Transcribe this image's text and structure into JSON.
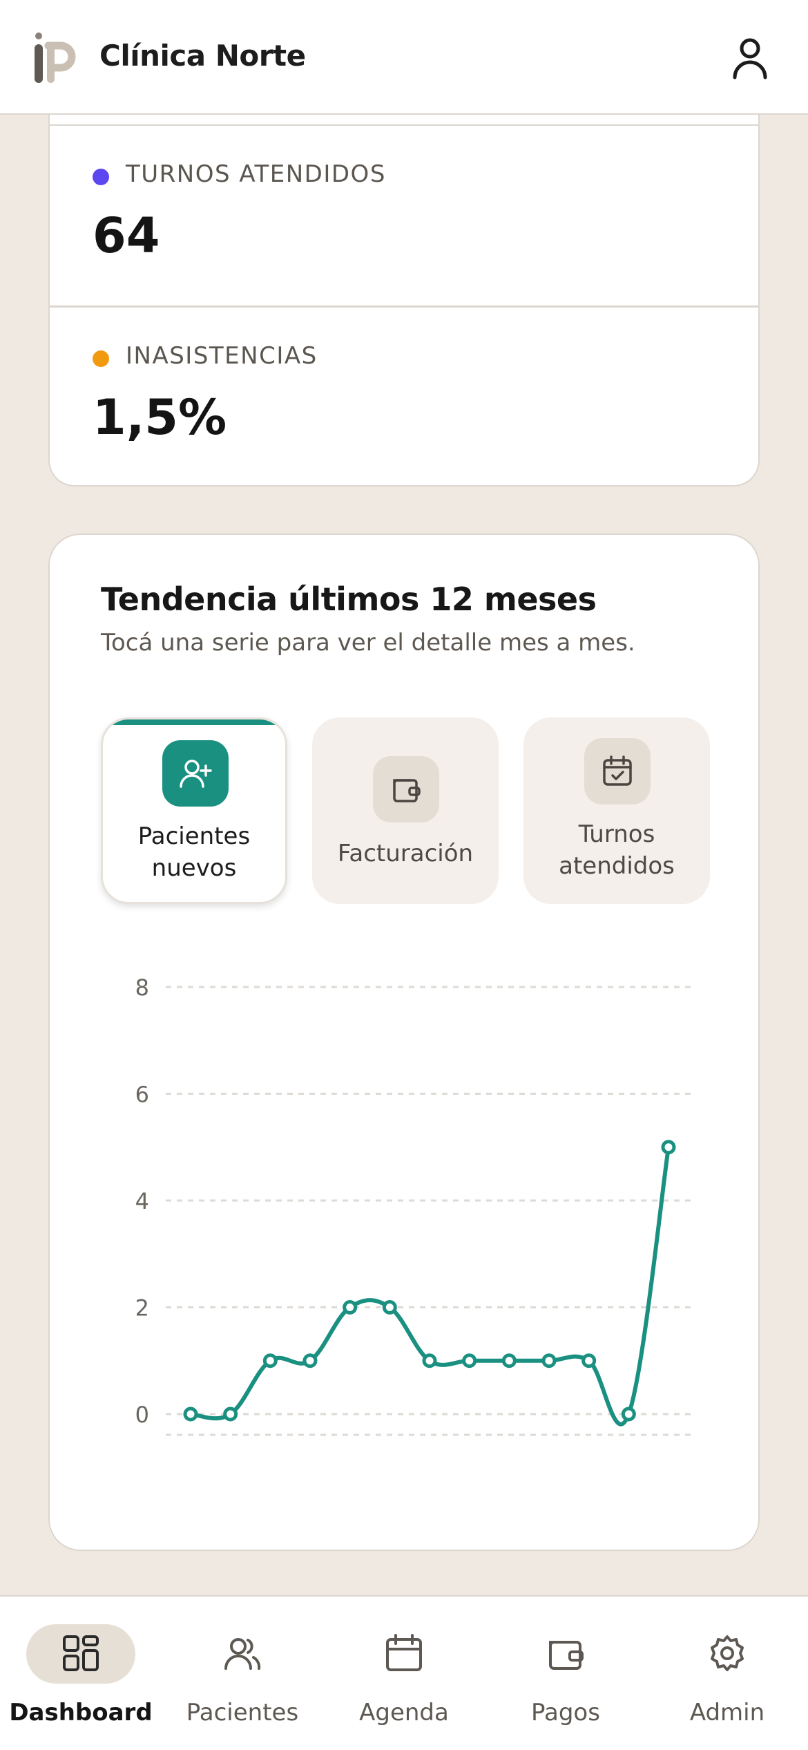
{
  "header": {
    "title": "Clínica Norte"
  },
  "stats": [
    {
      "label": "TURNOS ATENDIDOS",
      "value": "64",
      "color": "#5b46f0"
    },
    {
      "label": "INASISTENCIAS",
      "value": "1,5%",
      "color": "#f29a0f"
    }
  ],
  "trend": {
    "title": "Tendencia últimos 12 meses",
    "subtitle": "Tocá una serie para ver el detalle mes a mes.",
    "tabs": [
      {
        "label_line1": "Pacientes",
        "label_line2": "nuevos",
        "icon": "user-plus-icon",
        "active": true
      },
      {
        "label_line1": "Facturación",
        "label_line2": "",
        "icon": "wallet-icon",
        "active": false
      },
      {
        "label_line1": "Turnos",
        "label_line2": "atendidos",
        "icon": "calendar-check-icon",
        "active": false
      }
    ]
  },
  "chart_data": {
    "type": "line",
    "x": [
      1,
      2,
      3,
      4,
      5,
      6,
      7,
      8,
      9,
      10,
      11,
      12,
      13
    ],
    "series": [
      {
        "values": [
          0,
          0,
          1,
          1,
          2,
          2,
          1,
          1,
          1,
          1,
          1,
          0,
          5
        ],
        "color": "#1a9080"
      }
    ],
    "yticks": [
      "0",
      "2",
      "4",
      "6",
      "8"
    ],
    "ylim": [
      0,
      8
    ],
    "grid": true,
    "title": "",
    "xlabel": "",
    "ylabel": ""
  },
  "nav": [
    {
      "label": "Dashboard",
      "icon": "dashboard-icon",
      "active": true
    },
    {
      "label": "Pacientes",
      "icon": "users-icon",
      "active": false
    },
    {
      "label": "Agenda",
      "icon": "calendar-icon",
      "active": false
    },
    {
      "label": "Pagos",
      "icon": "wallet-icon",
      "active": false
    },
    {
      "label": "Admin",
      "icon": "gear-icon",
      "active": false
    }
  ],
  "colors": {
    "accent": "#1a9080",
    "background": "#efe9e2",
    "card": "#ffffff"
  }
}
